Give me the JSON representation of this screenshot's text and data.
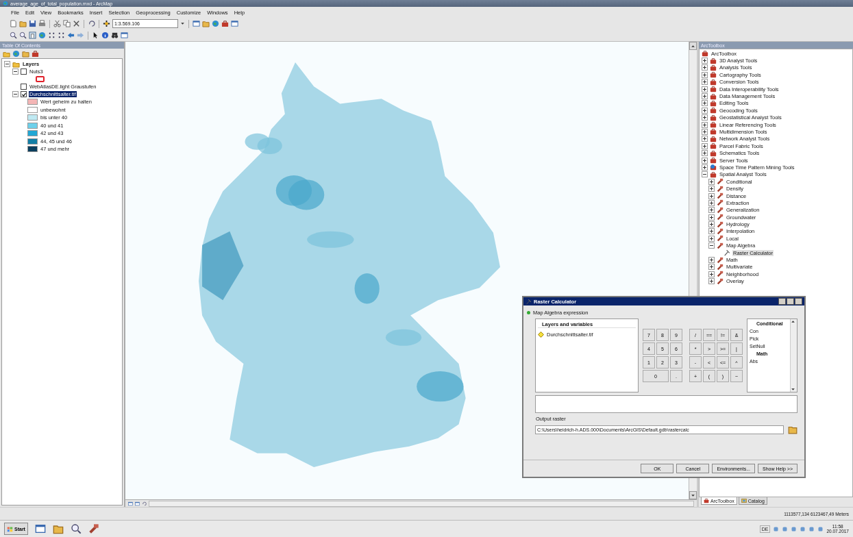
{
  "window": {
    "title": "average_age_of_total_population.mxd - ArcMap"
  },
  "menu": [
    "File",
    "Edit",
    "View",
    "Bookmarks",
    "Insert",
    "Selection",
    "Geoprocessing",
    "Customize",
    "Windows",
    "Help"
  ],
  "toolbar": {
    "scale": "1:3.569.106"
  },
  "toc": {
    "title": "Table Of Contents",
    "tree": [
      {
        "kind": "group",
        "label": "Layers",
        "expanded": true,
        "selected": false,
        "children": [
          {
            "kind": "layer",
            "label": "Nuts3",
            "checked": false,
            "expanded": true,
            "selected": false,
            "children": [
              {
                "kind": "symbol",
                "color": "#e0202a"
              }
            ]
          },
          {
            "kind": "layer",
            "label": "WebAtlasDE.light Graustufen",
            "checked": false,
            "selected": false
          },
          {
            "kind": "layer",
            "label": "Durchschnittsalter.tif",
            "checked": true,
            "expanded": true,
            "selected": true,
            "children": [
              {
                "kind": "legend",
                "label": "Wert geheim zu halten",
                "color": "#f4b6b6"
              },
              {
                "kind": "legend",
                "label": "unbewohnt",
                "color": "#ffffff"
              },
              {
                "kind": "legend",
                "label": "bis unter 40",
                "color": "#bfe9f2"
              },
              {
                "kind": "legend",
                "label": "40 und 41",
                "color": "#6dd0ea"
              },
              {
                "kind": "legend",
                "label": "42 und 43",
                "color": "#22a7d4"
              },
              {
                "kind": "legend",
                "label": "44, 45 und 46",
                "color": "#137fa6"
              },
              {
                "kind": "legend",
                "label": "47 und mehr",
                "color": "#0b3f5e"
              }
            ]
          }
        ]
      }
    ]
  },
  "toolbox": {
    "title": "ArcToolbox",
    "root": "ArcToolbox",
    "items": [
      {
        "label": "3D Analyst Tools",
        "kind": "toolbox",
        "expanded": false,
        "selected": false
      },
      {
        "label": "Analysis Tools",
        "kind": "toolbox",
        "expanded": false,
        "selected": false
      },
      {
        "label": "Cartography Tools",
        "kind": "toolbox",
        "expanded": false,
        "selected": false
      },
      {
        "label": "Conversion Tools",
        "kind": "toolbox",
        "expanded": false,
        "selected": false
      },
      {
        "label": "Data Interoperability Tools",
        "kind": "toolbox",
        "expanded": false,
        "selected": false
      },
      {
        "label": "Data Management Tools",
        "kind": "toolbox",
        "expanded": false,
        "selected": false
      },
      {
        "label": "Editing Tools",
        "kind": "toolbox",
        "expanded": false,
        "selected": false
      },
      {
        "label": "Geocoding Tools",
        "kind": "toolbox",
        "expanded": false,
        "selected": false
      },
      {
        "label": "Geostatistical Analyst Tools",
        "kind": "toolbox",
        "expanded": false,
        "selected": false
      },
      {
        "label": "Linear Referencing Tools",
        "kind": "toolbox",
        "expanded": false,
        "selected": false
      },
      {
        "label": "Multidimension Tools",
        "kind": "toolbox",
        "expanded": false,
        "selected": false
      },
      {
        "label": "Network Analyst Tools",
        "kind": "toolbox",
        "expanded": false,
        "selected": false
      },
      {
        "label": "Parcel Fabric Tools",
        "kind": "toolbox",
        "expanded": false,
        "selected": false
      },
      {
        "label": "Schematics Tools",
        "kind": "toolbox",
        "expanded": false,
        "selected": false
      },
      {
        "label": "Server Tools",
        "kind": "toolbox",
        "expanded": false,
        "selected": false
      },
      {
        "label": "Space Time Pattern Mining Tools",
        "kind": "script-toolbox",
        "expanded": false,
        "selected": false
      },
      {
        "label": "Spatial Analyst Tools",
        "kind": "toolbox",
        "expanded": true,
        "selected": false,
        "children": [
          {
            "label": "Conditional",
            "kind": "toolset",
            "expanded": false,
            "selected": false
          },
          {
            "label": "Density",
            "kind": "toolset",
            "expanded": false,
            "selected": false
          },
          {
            "label": "Distance",
            "kind": "toolset",
            "expanded": false,
            "selected": false
          },
          {
            "label": "Extraction",
            "kind": "toolset",
            "expanded": false,
            "selected": false
          },
          {
            "label": "Generalization",
            "kind": "toolset",
            "expanded": false,
            "selected": false
          },
          {
            "label": "Groundwater",
            "kind": "toolset",
            "expanded": false,
            "selected": false
          },
          {
            "label": "Hydrology",
            "kind": "toolset",
            "expanded": false,
            "selected": false
          },
          {
            "label": "Interpolation",
            "kind": "toolset",
            "expanded": false,
            "selected": false
          },
          {
            "label": "Local",
            "kind": "toolset",
            "expanded": false,
            "selected": false
          },
          {
            "label": "Map Algebra",
            "kind": "toolset",
            "expanded": true,
            "selected": false,
            "children": [
              {
                "label": "Raster Calculator",
                "kind": "tool",
                "selected": true
              }
            ]
          },
          {
            "label": "Math",
            "kind": "toolset",
            "expanded": false,
            "selected": false
          },
          {
            "label": "Multivariate",
            "kind": "toolset",
            "expanded": false,
            "selected": false
          },
          {
            "label": "Neighborhood",
            "kind": "toolset",
            "expanded": false,
            "selected": false
          },
          {
            "label": "Overlay",
            "kind": "toolset",
            "expanded": false,
            "selected": false
          }
        ]
      }
    ],
    "tabs": [
      {
        "label": "ArcToolbox",
        "selected": true
      },
      {
        "label": "Catalog",
        "selected": false
      }
    ]
  },
  "dialog": {
    "title": "Raster Calculator",
    "section": "Map Algebra expression",
    "layers_header": "Layers and variables",
    "layers": [
      "Durchschnittsalter.tif"
    ],
    "keypad": [
      [
        "7",
        "8",
        "9",
        "/",
        "==",
        "!=",
        "&"
      ],
      [
        "4",
        "5",
        "6",
        "*",
        ">",
        ">=",
        "|"
      ],
      [
        "1",
        "2",
        "3",
        "-",
        "<",
        "<=",
        "^"
      ],
      [
        "0",
        ".",
        "+",
        "(",
        ")",
        "~"
      ]
    ],
    "functions": [
      {
        "kind": "header",
        "label": "Conditional"
      },
      {
        "kind": "item",
        "label": "Con"
      },
      {
        "kind": "item",
        "label": "Pick"
      },
      {
        "kind": "item",
        "label": "SetNull"
      },
      {
        "kind": "header",
        "label": "Math"
      },
      {
        "kind": "item",
        "label": "Abs"
      }
    ],
    "output_label": "Output raster",
    "output_value": "C:\\Users\\heidrich-h.ADS.000\\Documents\\ArcGIS\\Default.gdb\\rastercalc",
    "buttons": [
      "OK",
      "Cancel",
      "Environments...",
      "Show Help >>"
    ]
  },
  "status": {
    "coordinates": "1113577,134  6123467,49 Meters"
  },
  "taskbar": {
    "start": "Start",
    "language": "DE",
    "time": "11:58",
    "date": "20.07.2017"
  }
}
